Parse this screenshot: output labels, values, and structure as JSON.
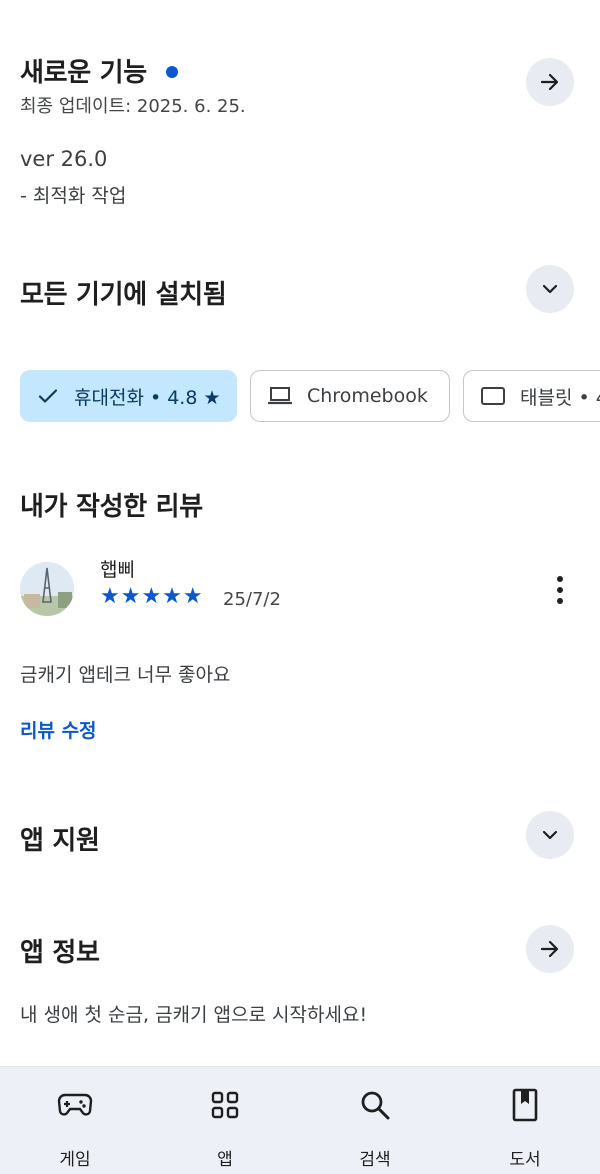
{
  "whats_new": {
    "title": "새로운 기능",
    "updated": "최종 업데이트: 2025. 6. 25.",
    "version": "ver 26.0",
    "note": "- 최적화 작업"
  },
  "devices": {
    "title": "모든 기기에 설치됨",
    "chips": [
      {
        "label": "휴대전화 • 4.8 ★",
        "icon": "check-icon",
        "selected": true
      },
      {
        "label": "Chromebook",
        "icon": "laptop-icon",
        "selected": false
      },
      {
        "label": "태블릿 • 4",
        "icon": "tablet-icon",
        "selected": false
      }
    ]
  },
  "my_review": {
    "title": "내가 작성한 리뷰",
    "author": "햅삐",
    "rating": 5,
    "stars_text": "★★★★★",
    "date": "25/7/2",
    "text": "금캐기 앱테크 너무 좋아요",
    "edit_label": "리뷰 수정"
  },
  "app_support": {
    "title": "앱 지원"
  },
  "app_info": {
    "title": "앱 정보",
    "description": "내 생애 첫 순금, 금캐기 앱으로 시작하세요!"
  },
  "bottom_nav": [
    {
      "label": "게임",
      "icon": "gamepad-icon"
    },
    {
      "label": "앱",
      "icon": "apps-grid-icon"
    },
    {
      "label": "검색",
      "icon": "search-icon"
    },
    {
      "label": "도서",
      "icon": "book-icon"
    }
  ],
  "colors": {
    "accent": "#0b57d0",
    "chip_selected_bg": "#c2e7ff",
    "button_bg": "#e8ebf2",
    "nav_bg": "#edf0f6"
  }
}
